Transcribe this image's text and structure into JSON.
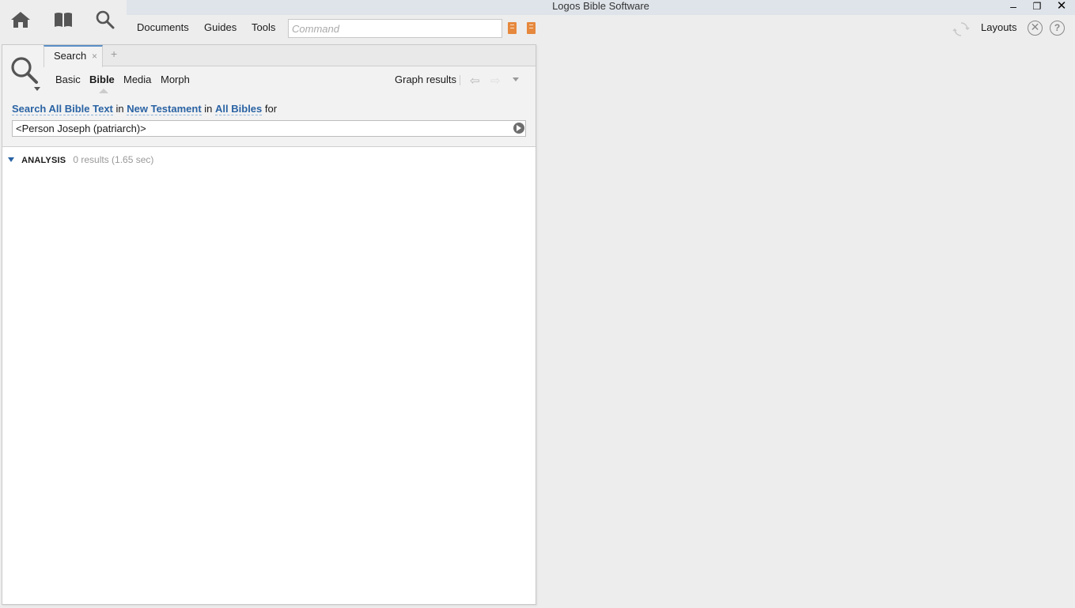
{
  "window": {
    "title": "Logos Bible Software",
    "minimize": "–",
    "restore": "❐",
    "close": "✕"
  },
  "toolbar": {
    "menu": [
      "Documents",
      "Guides",
      "Tools"
    ],
    "command_placeholder": "Command",
    "layouts_label": "Layouts",
    "help_label": "?",
    "close_panel_label": "✕"
  },
  "panel": {
    "tab_label": "Search",
    "tab_close": "×",
    "tab_add": "+",
    "subtabs": [
      "Basic",
      "Bible",
      "Media",
      "Morph"
    ],
    "active_subtab": "Bible",
    "graph_results": "Graph results",
    "back_arrow": "⇦",
    "forward_arrow": "⇨",
    "search_line": {
      "search_what": "Search All Bible Text",
      "in1": "in",
      "range": "New Testament",
      "in2": "in",
      "bibles": "All Bibles",
      "for": "for"
    },
    "query": "<Person Joseph (patriarch)>",
    "analysis_label": "ANALYSIS",
    "results": "0 results (1.65 sec)"
  },
  "icons": {
    "home": "home-icon",
    "library": "library-book-icon",
    "search": "search-icon",
    "sync": "sync-icon"
  },
  "colors": {
    "link": "#2a63a4",
    "accent_orange": "#e6883d",
    "titlebar": "#dfe4ea"
  }
}
